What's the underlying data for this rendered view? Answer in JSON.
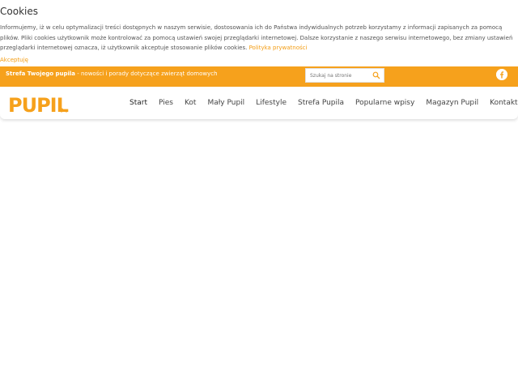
{
  "cookies": {
    "title": "Cookies",
    "text": "Informujemy, iż w celu optymalizacji treści dostępnych w naszym serwisie, dostosowania ich do Państwa indywidualnych potrzeb korzystamy z informacji zapisanych za pomocą plików. Pliki cookies użytkownik może kontrolować za pomocą ustawień swojej przeglądarki internetowej. Dalsze korzystanie z naszego serwisu internetowego, bez zmiany ustawień przeglądarki internetowej oznacza, iż użytkownik akceptuje stosowanie plików cookies.",
    "privacy_link": "Polityka prywatności",
    "accept_label": "Akceptuję"
  },
  "topbar": {
    "tagline_bold": "Strefa Twojego pupila",
    "tagline_rest": " - nowości i porady dotyczące zwierząt domowych",
    "search_placeholder": "Szukaj na stronie",
    "search_icon": "search-icon",
    "social_icon": "facebook-icon",
    "bg_color": "#f6a11c"
  },
  "header": {
    "logo_text": "PUPIL"
  },
  "nav": {
    "items": [
      {
        "label": "Start"
      },
      {
        "label": "Pies"
      },
      {
        "label": "Kot"
      },
      {
        "label": "Mały Pupil"
      },
      {
        "label": "Lifestyle"
      },
      {
        "label": "Strefa Pupila"
      },
      {
        "label": "Popularne wpisy"
      },
      {
        "label": "Magazyn Pupil"
      },
      {
        "label": "Kontakt"
      }
    ]
  }
}
